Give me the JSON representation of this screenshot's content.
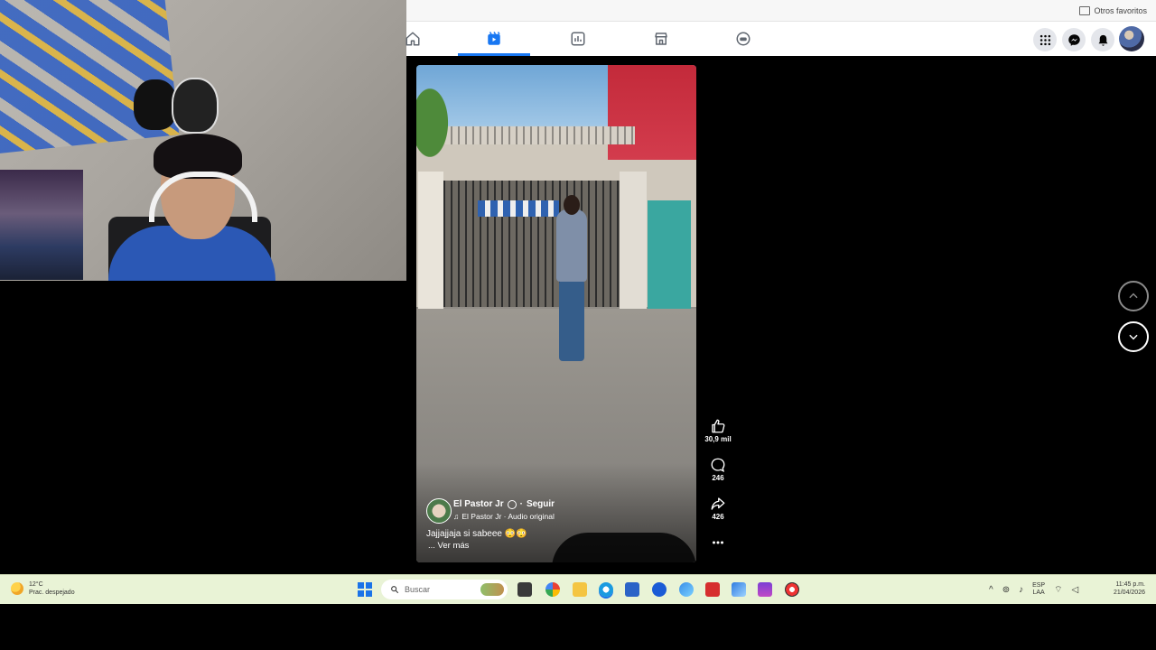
{
  "browser": {
    "favorites_label": "Otros favoritos",
    "nav_tabs": [
      {
        "name": "home",
        "icon": "home-icon",
        "active": false
      },
      {
        "name": "reels",
        "icon": "video-icon",
        "active": true
      },
      {
        "name": "groups",
        "icon": "groups-icon",
        "active": false
      },
      {
        "name": "marketplace",
        "icon": "marketplace-icon",
        "active": false
      },
      {
        "name": "gaming",
        "icon": "gaming-icon",
        "active": false
      }
    ],
    "accent_color": "#1877f2"
  },
  "reel": {
    "author": "El Pastor Jr",
    "follow_label": "Seguir",
    "audio": "El Pastor Jr · Audio original",
    "caption": "Jajjajjaja si sabeee 😳😳",
    "see_more": "... Ver más",
    "likes": "30,9 mil",
    "comments": "246",
    "shares": "426"
  },
  "taskbar": {
    "weather_temp": "12°C",
    "weather_desc": "Prac. despejado",
    "search_placeholder": "Buscar",
    "lang_top": "ESP",
    "lang_bottom": "LAA",
    "time": "11:45 p.m.",
    "date": "21/04/2026"
  }
}
